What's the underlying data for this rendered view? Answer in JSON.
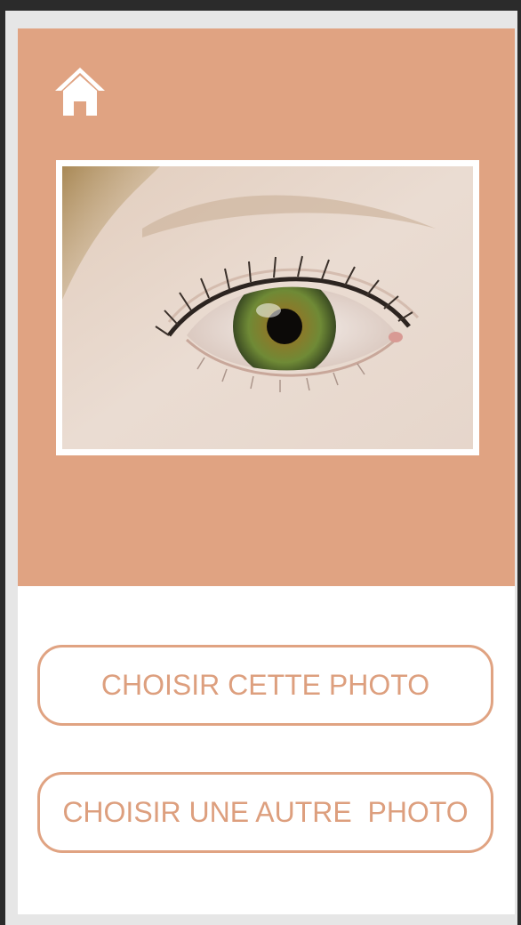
{
  "colors": {
    "accent": "#e0a382",
    "button_text": "#dd9f7e",
    "background": "#ffffff",
    "outer_frame": "#2b2b2b"
  },
  "header": {
    "home_icon": "home-icon"
  },
  "preview": {
    "image_subject": "eye-photo"
  },
  "actions": {
    "choose_this_label": "CHOISIR CETTE PHOTO",
    "choose_another_label": "CHOISIR UNE AUTRE  PHOTO"
  }
}
